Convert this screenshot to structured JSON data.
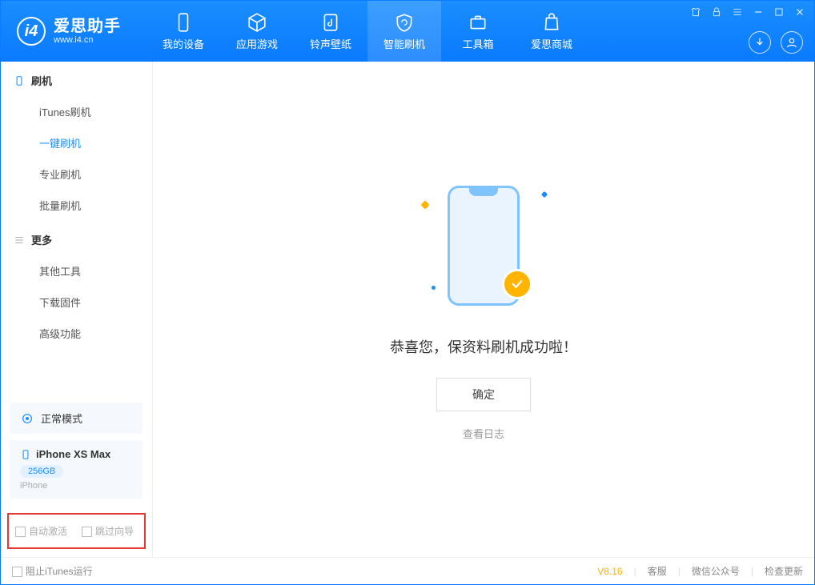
{
  "header": {
    "logo_title": "爱思助手",
    "logo_sub": "www.i4.cn",
    "tabs": [
      {
        "label": "我的设备"
      },
      {
        "label": "应用游戏"
      },
      {
        "label": "铃声壁纸"
      },
      {
        "label": "智能刷机"
      },
      {
        "label": "工具箱"
      },
      {
        "label": "爱思商城"
      }
    ]
  },
  "sidebar": {
    "group1_title": "刷机",
    "group1_items": [
      {
        "label": "iTunes刷机"
      },
      {
        "label": "一键刷机"
      },
      {
        "label": "专业刷机"
      },
      {
        "label": "批量刷机"
      }
    ],
    "group2_title": "更多",
    "group2_items": [
      {
        "label": "其他工具"
      },
      {
        "label": "下载固件"
      },
      {
        "label": "高级功能"
      }
    ],
    "mode_label": "正常模式",
    "device": {
      "name": "iPhone XS Max",
      "storage": "256GB",
      "type": "iPhone"
    },
    "checkbox1": "自动激活",
    "checkbox2": "跳过向导"
  },
  "main": {
    "success_text": "恭喜您，保资料刷机成功啦！",
    "ok_button": "确定",
    "log_link": "查看日志"
  },
  "statusbar": {
    "block_itunes": "阻止iTunes运行",
    "version": "V8.16",
    "link1": "客服",
    "link2": "微信公众号",
    "link3": "检查更新"
  }
}
